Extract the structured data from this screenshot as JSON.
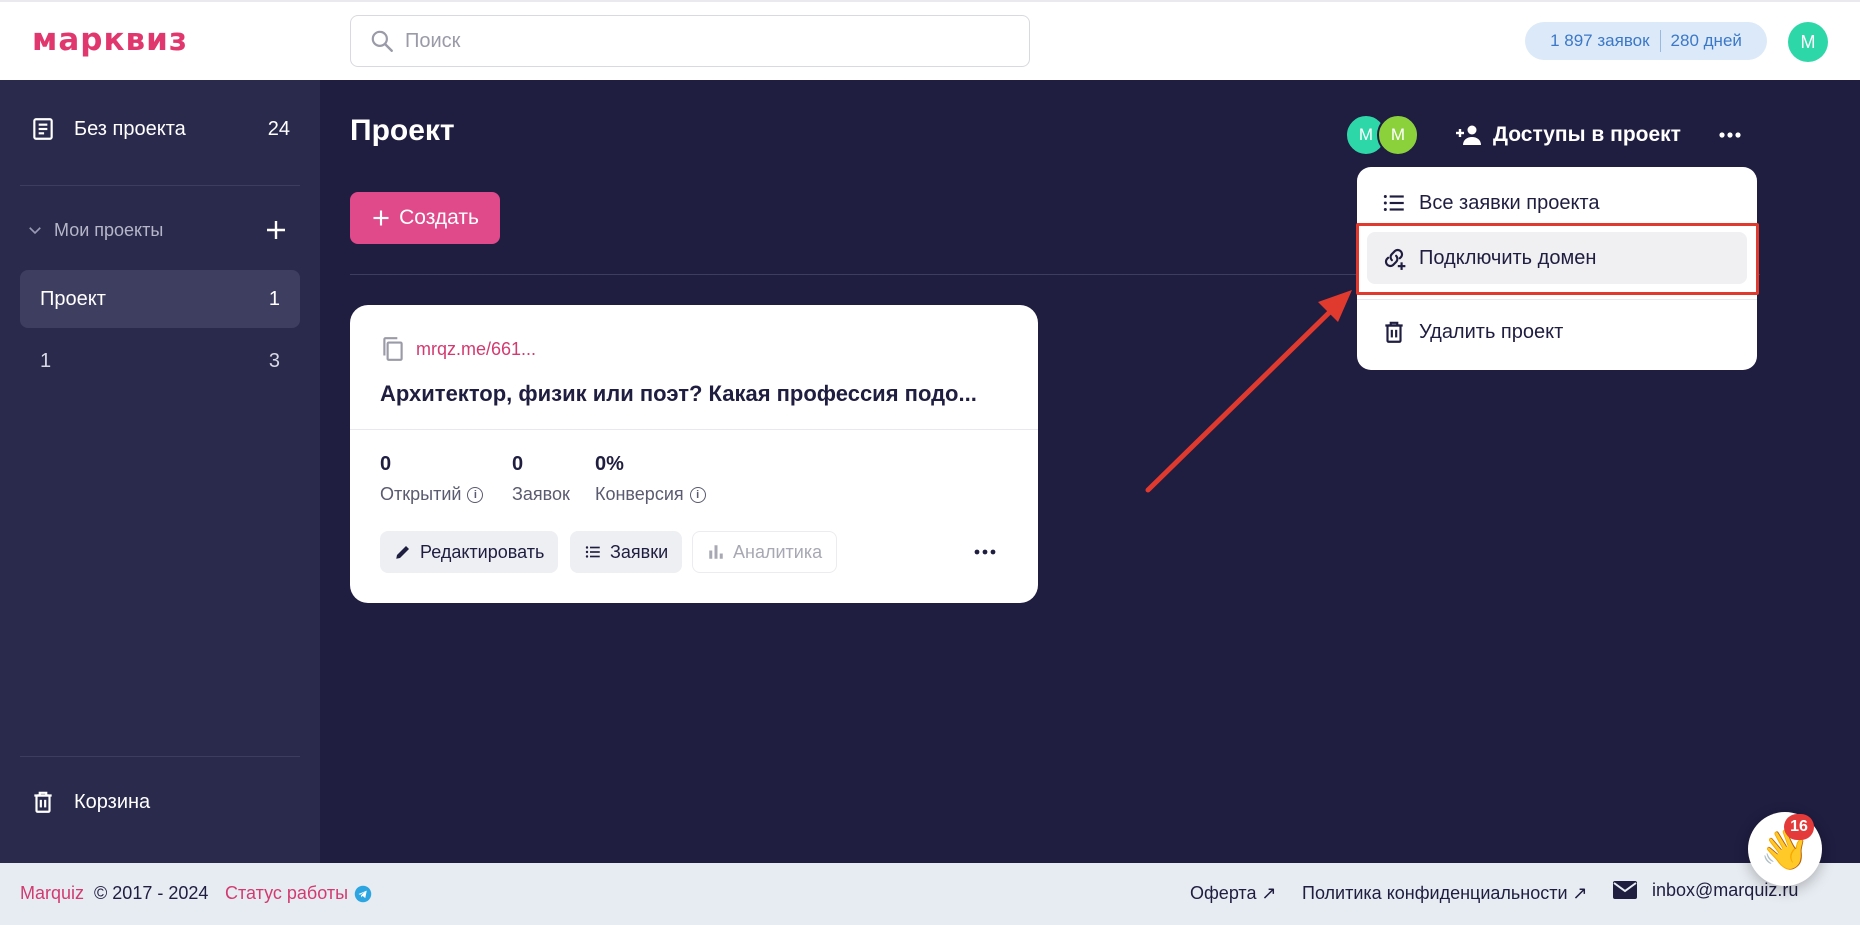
{
  "header": {
    "logo": "марквиз",
    "search_placeholder": "Поиск",
    "leads_count": "1 897 заявок",
    "days_left": "280 дней",
    "user_avatar": "M"
  },
  "sidebar": {
    "no_project_label": "Без проекта",
    "no_project_count": "24",
    "my_projects_label": "Мои проекты",
    "projects": [
      {
        "label": "Проект",
        "count": "1"
      },
      {
        "label": "1",
        "count": "3"
      }
    ],
    "trash_label": "Корзина"
  },
  "main": {
    "title": "Проект",
    "create_label": "Создать",
    "access_avatars": [
      "M",
      "M"
    ],
    "access_label": "Доступы в проект"
  },
  "dropdown": {
    "items": [
      {
        "label": "Все заявки проекта"
      },
      {
        "label": "Подключить домен"
      },
      {
        "label": "Удалить проект"
      }
    ]
  },
  "card": {
    "link": "mrqz.me/661...",
    "title": "Архитектор, физик или поэт? Какая профессия подо...",
    "stats": [
      {
        "value": "0",
        "label": "Открытий"
      },
      {
        "value": "0",
        "label": "Заявок"
      },
      {
        "value": "0%",
        "label": "Конверсия"
      }
    ],
    "edit_label": "Редактировать",
    "leads_label": "Заявки",
    "analytics_label": "Аналитика"
  },
  "footer": {
    "brand": "Marquiz",
    "copyright": "© 2017 - 2024",
    "status_label": "Статус работы",
    "offer_label": "Оферта ↗",
    "privacy_label": "Политика конфиденциальности ↗",
    "email": "inbox@marquiz.ru"
  },
  "chat": {
    "badge": "16"
  },
  "colors": {
    "accent": "#e0498a",
    "sidebar_bg": "#2a2a4d",
    "main_bg": "#1f1d40",
    "highlight": "#e03a2e"
  }
}
